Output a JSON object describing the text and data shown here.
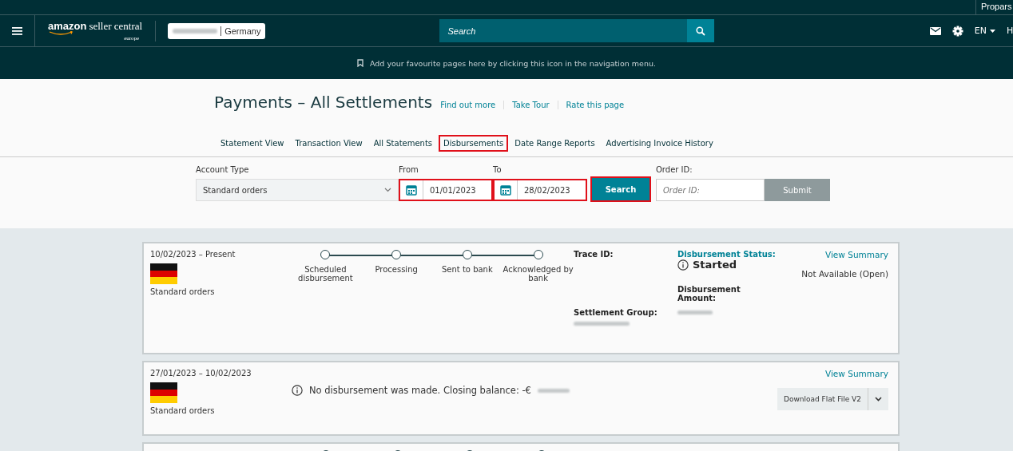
{
  "topbar": {
    "account_name": "Propars"
  },
  "header": {
    "logo_main": "amazon",
    "logo_sub": "seller central",
    "logo_region": "europe",
    "marketplace": "Germany",
    "search_placeholder": "Search",
    "language": "EN",
    "cut_link": "H"
  },
  "favourites_bar": {
    "text": "Add your favourite pages here by clicking this icon in the navigation menu."
  },
  "page": {
    "title": "Payments – All Settlements",
    "links": [
      "Find out more",
      "Take Tour",
      "Rate this page"
    ]
  },
  "tabs": [
    {
      "label": "Statement View",
      "highlighted": false
    },
    {
      "label": "Transaction View",
      "highlighted": false
    },
    {
      "label": "All Statements",
      "highlighted": false
    },
    {
      "label": "Disbursements",
      "highlighted": true
    },
    {
      "label": "Date Range Reports",
      "highlighted": false
    },
    {
      "label": "Advertising Invoice History",
      "highlighted": false
    }
  ],
  "filters": {
    "account_type_label": "Account Type",
    "account_type_value": "Standard orders",
    "from_label": "From",
    "from_value": "01/01/2023",
    "from_highlighted": true,
    "to_label": "To",
    "to_value": "28/02/2023",
    "to_highlighted": true,
    "search_button": "Search",
    "search_highlighted": true,
    "order_id_label": "Order ID:",
    "order_id_placeholder": "Order ID:",
    "submit_button": "Submit"
  },
  "settlements": [
    {
      "kind": "progress",
      "period": "10/02/2023 – Present",
      "account": "Standard orders",
      "steps": [
        "Scheduled disbursement",
        "Processing",
        "Sent to bank",
        "Acknowledged by bank"
      ],
      "trace_id_label": "Trace ID:",
      "settlement_group_label": "Settlement Group:",
      "status_label": "Disbursement Status:",
      "status": "Started",
      "amount_label": "Disbursement Amount:",
      "view_summary": "View Summary",
      "note": "Not Available (Open)"
    },
    {
      "kind": "no_disbursement",
      "period": "27/01/2023 – 10/02/2023",
      "account": "Standard orders",
      "message": "No disbursement was made. Closing balance: -€",
      "view_summary": "View Summary",
      "download_button": "Download Flat File V2"
    },
    {
      "kind": "cut"
    }
  ]
}
